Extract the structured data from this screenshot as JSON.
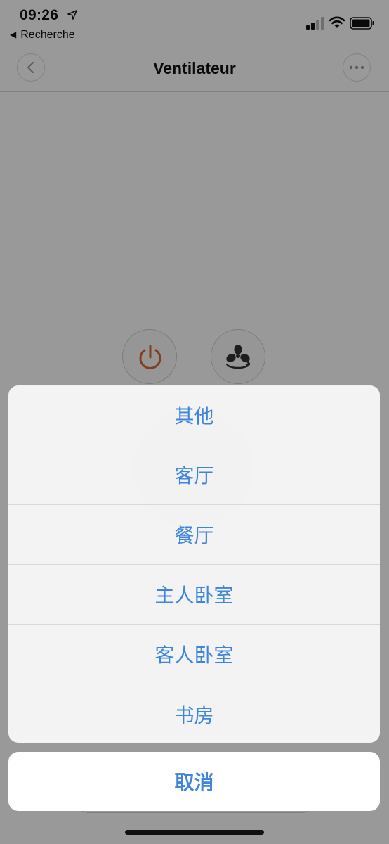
{
  "status_bar": {
    "time": "09:26",
    "back_app": "Recherche"
  },
  "nav": {
    "title": "Ventilateur"
  },
  "colors": {
    "accent": "#3f86db",
    "power": "#d9692f",
    "overlay": "#9b9b9b"
  },
  "action_sheet": {
    "items": [
      {
        "label": "其他"
      },
      {
        "label": "客厅"
      },
      {
        "label": "餐厅"
      },
      {
        "label": "主人卧室"
      },
      {
        "label": "客人卧室"
      },
      {
        "label": "书房"
      }
    ],
    "cancel_label": "取消"
  }
}
